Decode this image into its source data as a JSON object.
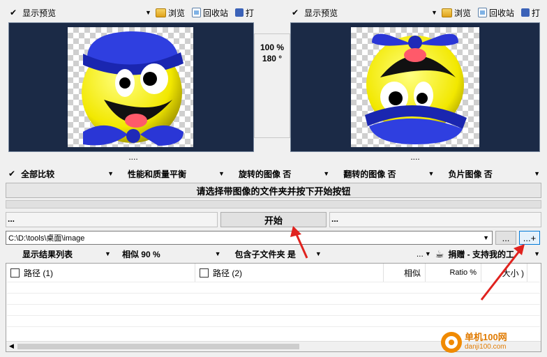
{
  "left_toolbar": {
    "show_preview": "显示预览",
    "browse": "浏览",
    "recycle": "回收站",
    "print": "打"
  },
  "right_toolbar": {
    "show_preview": "显示预览",
    "browse": "浏览",
    "recycle": "回收站",
    "print": "打"
  },
  "left_preview_dots": "....",
  "right_preview_dots": "....",
  "center_info": {
    "zoom": "100 %",
    "rotation": "180 °"
  },
  "options": {
    "compare_all": "全部比较",
    "performance": "性能和质量平衡",
    "rotated": "旋转的图像 否",
    "flipped": "翻转的图像 否",
    "negative": "负片图像 否"
  },
  "status_message": "请选择带图像的文件夹并按下开始按钮",
  "start_row": {
    "left_dots": "...",
    "start_label": "开始",
    "right_dots": "..."
  },
  "path": {
    "value": "C:\\D:\\tools\\桌面\\image",
    "browse_label": "...",
    "add_label": "...+"
  },
  "results_bar": {
    "show_list": "显示结果列表",
    "similarity": "相似 90 %",
    "subfolders": "包含子文件夹 是",
    "more": "...",
    "donate": "捐赠 - 支持我的工"
  },
  "table": {
    "col_path1": "路径 (1)",
    "col_path2": "路径 (2)",
    "col_similar": "相似",
    "col_ratio": "Ratio %",
    "col_size": "大小 )"
  },
  "watermark": {
    "site": "单机100网",
    "url": "danji100.com"
  },
  "colors": {
    "preview_bg": "#1b2a46",
    "accent": "#0078d7",
    "arrow": "#e0221e"
  }
}
